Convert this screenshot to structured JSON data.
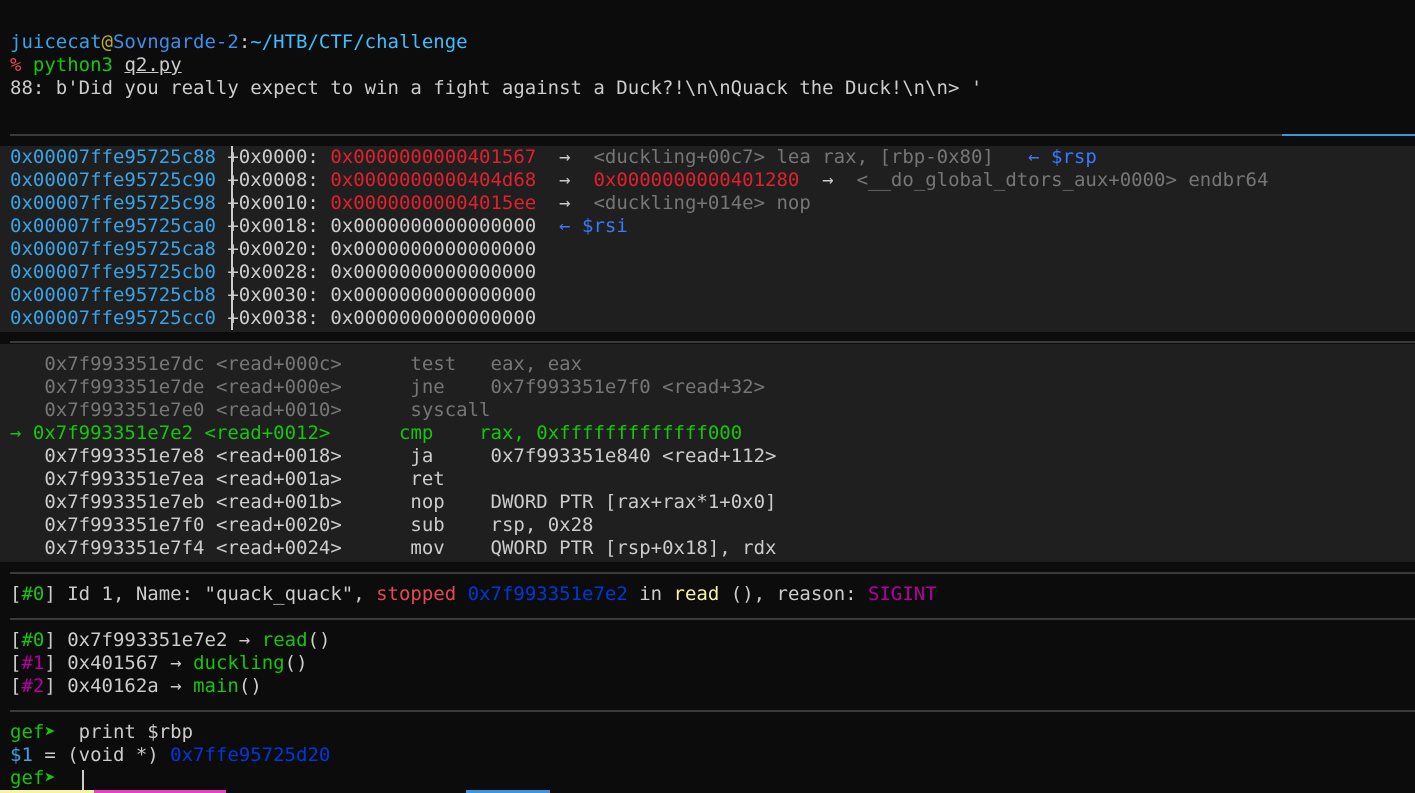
{
  "prompt": {
    "user": "juicecat",
    "at": "@",
    "host": "Sovngarde-2",
    "colon": ":",
    "path": "~/HTB/CTF/challenge"
  },
  "cmd": {
    "symbol": "%",
    "program": "python3",
    "file": "q2.py"
  },
  "output_line": "88: b'Did you really expect to win a fight against a Duck?!\\n\\nQuack the Duck!\\n\\n> '",
  "stack": [
    {
      "addr": "0x00007ffe95725c88",
      "off": "+0x0000:",
      "val": "0x0000000000401567",
      "arrow": "→",
      "sym": "<duckling+00c7> lea rax, [rbp-0x80]",
      "reg": "← $rsp"
    },
    {
      "addr": "0x00007ffe95725c90",
      "off": "+0x0008:",
      "val": "0x0000000000404d68",
      "arrow": "→",
      "sym": "0x0000000000401280",
      "arrow2": "→",
      "sym2": "<__do_global_dtors_aux+0000> endbr64"
    },
    {
      "addr": "0x00007ffe95725c98",
      "off": "+0x0010:",
      "val": "0x00000000004015ee",
      "arrow": "→",
      "sym": "<duckling+014e> nop"
    },
    {
      "addr": "0x00007ffe95725ca0",
      "off": "+0x0018:",
      "val": "0x0000000000000000",
      "reg": "← $rsi"
    },
    {
      "addr": "0x00007ffe95725ca8",
      "off": "+0x0020:",
      "val": "0x0000000000000000"
    },
    {
      "addr": "0x00007ffe95725cb0",
      "off": "+0x0028:",
      "val": "0x0000000000000000"
    },
    {
      "addr": "0x00007ffe95725cb8",
      "off": "+0x0030:",
      "val": "0x0000000000000000"
    },
    {
      "addr": "0x00007ffe95725cc0",
      "off": "+0x0038:",
      "val": "0x0000000000000000"
    }
  ],
  "code": [
    {
      "marker": "",
      "addr": "0x7f993351e7dc",
      "sym": "<read+000c>",
      "mn": "test",
      "ops": "eax, eax"
    },
    {
      "marker": "",
      "addr": "0x7f993351e7de",
      "sym": "<read+000e>",
      "mn": "jne",
      "ops": "0x7f993351e7f0 <read+32>"
    },
    {
      "marker": "",
      "addr": "0x7f993351e7e0",
      "sym": "<read+0010>",
      "mn": "syscall",
      "ops": ""
    },
    {
      "marker": "→",
      "addr": "0x7f993351e7e2",
      "sym": "<read+0012>",
      "mn": "cmp",
      "ops": "rax, 0xfffffffffffff000"
    },
    {
      "marker": "",
      "addr": "0x7f993351e7e8",
      "sym": "<read+0018>",
      "mn": "ja",
      "ops": "0x7f993351e840 <read+112>"
    },
    {
      "marker": "",
      "addr": "0x7f993351e7ea",
      "sym": "<read+001a>",
      "mn": "ret",
      "ops": ""
    },
    {
      "marker": "",
      "addr": "0x7f993351e7eb",
      "sym": "<read+001b>",
      "mn": "nop",
      "ops": "DWORD PTR [rax+rax*1+0x0]"
    },
    {
      "marker": "",
      "addr": "0x7f993351e7f0",
      "sym": "<read+0020>",
      "mn": "sub",
      "ops": "rsp, 0x28"
    },
    {
      "marker": "",
      "addr": "0x7f993351e7f4",
      "sym": "<read+0024>",
      "mn": "mov",
      "ops": "QWORD PTR [rsp+0x18], rdx"
    }
  ],
  "thread": {
    "lb": "[",
    "id": "#0",
    "rb": "]",
    "text1": " Id 1, Name: \"quack_quack\", ",
    "stopped": "stopped",
    "addr": "0x7f993351e7e2",
    "in": " in ",
    "func": "read",
    "text2": " (), reason: ",
    "reason": "SIGINT"
  },
  "trace": [
    {
      "num": "#0",
      "addr": "0x7f993351e7e2",
      "arrow": "→",
      "func": "read",
      "paren": "()"
    },
    {
      "num": "#1",
      "addr": "0x401567",
      "arrow": "→",
      "func": "duckling",
      "paren": "()"
    },
    {
      "num": "#2",
      "addr": "0x40162a",
      "arrow": "→",
      "func": "main",
      "paren": "()"
    }
  ],
  "gef": {
    "prompt": "gef➤",
    "cmd": "print $rbp",
    "result_var": "$1",
    "result_text": " = (void *) ",
    "result_val": "0x7ffe95725d20",
    "prompt2": "gef➤"
  }
}
